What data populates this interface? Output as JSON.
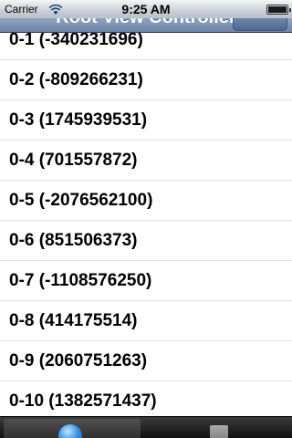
{
  "status_bar": {
    "carrier": "Carrier",
    "time": "9:25 AM"
  },
  "nav_bar": {
    "title": "Root View Controller"
  },
  "table": {
    "rows": [
      "0-1 (-340231696)",
      "0-2 (-809266231)",
      "0-3 (1745939531)",
      "0-4 (701557872)",
      "0-5 (-2076562100)",
      "0-6 (851506373)",
      "0-7 (-1108576250)",
      "0-8 (414175514)",
      "0-9 (2060751263)",
      "0-10 (1382571437)"
    ]
  },
  "tab_bar": {
    "icons": [
      "globe-icon",
      "square-icon"
    ]
  }
}
